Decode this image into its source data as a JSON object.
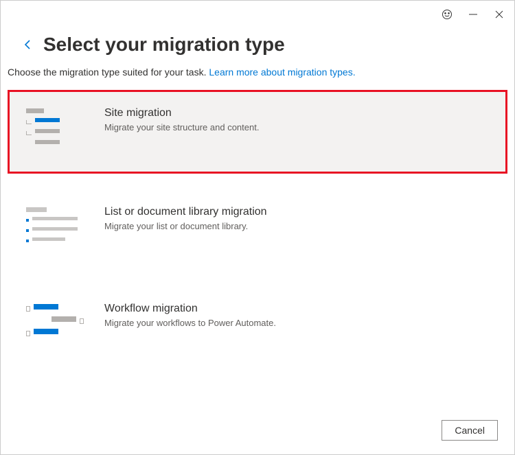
{
  "header": {
    "title": "Select your migration type"
  },
  "intro": {
    "text": "Choose the migration type suited for your task. ",
    "link_text": "Learn more about migration types."
  },
  "options": [
    {
      "title": "Site migration",
      "desc": "Migrate your site structure and content."
    },
    {
      "title": "List or document library migration",
      "desc": "Migrate your list or document library."
    },
    {
      "title": "Workflow migration",
      "desc": "Migrate your workflows to Power Automate."
    }
  ],
  "footer": {
    "cancel": "Cancel"
  }
}
